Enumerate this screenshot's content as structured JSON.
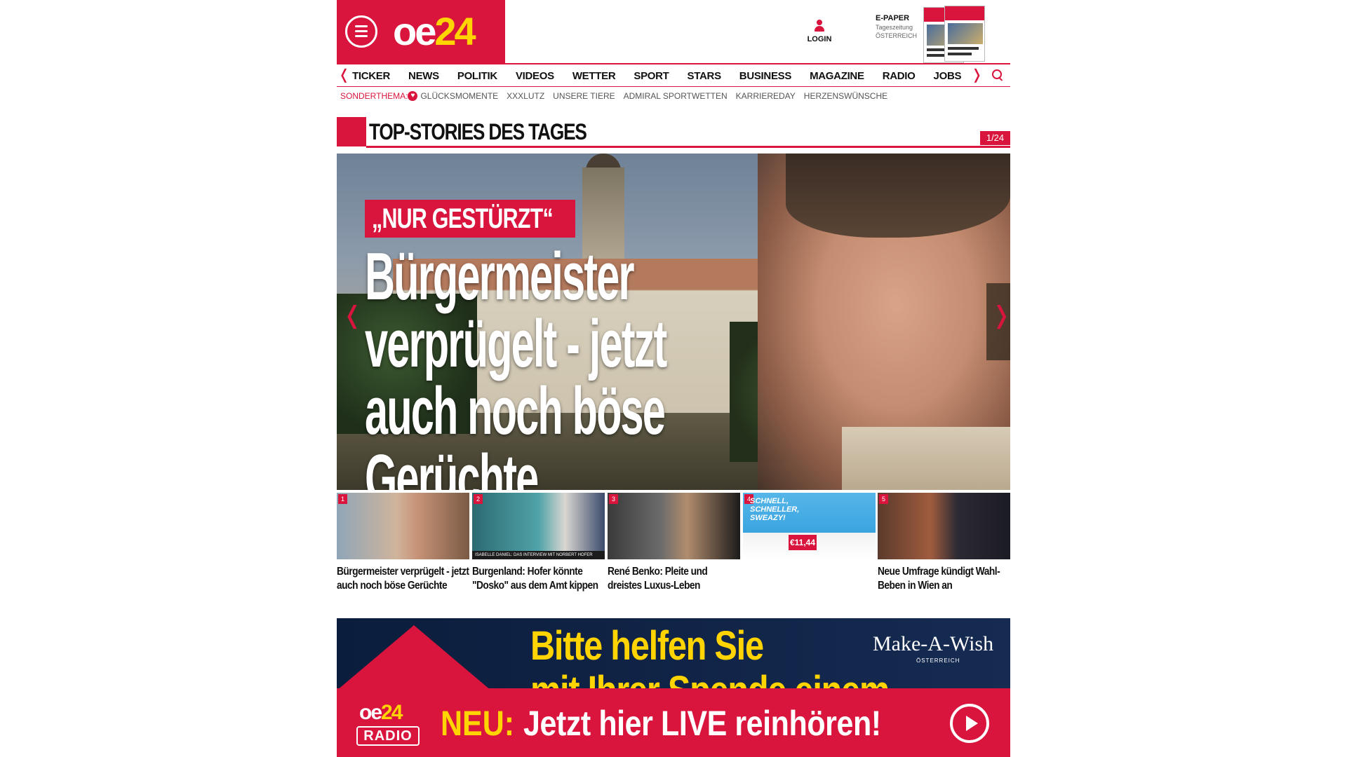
{
  "brand": {
    "logo_prefix": "oe",
    "logo_number": "24"
  },
  "header": {
    "login_label": "LOGIN",
    "epaper_title": "E-PAPER",
    "epaper_sub1": "Tageszeitung",
    "epaper_sub2": "ÖSTERREICH"
  },
  "nav": {
    "items": [
      "TICKER",
      "NEWS",
      "POLITIK",
      "VIDEOS",
      "WETTER",
      "SPORT",
      "STARS",
      "BUSINESS",
      "MAGAZINE",
      "RADIO",
      "JOBS"
    ],
    "prev_arrow": "❬",
    "next_arrow": "❭"
  },
  "subnav": {
    "label": "SONDERTHEMA:",
    "items": [
      "GLÜCKSMOMENTE",
      "XXXLUTZ",
      "UNSERE TIERE",
      "ADMIRAL SPORTWETTEN",
      "KARRIEREDAY",
      "HERZENSWÜNSCHE"
    ]
  },
  "section": {
    "title": "TOP-STORIES DES TAGES",
    "counter": "1/24"
  },
  "hero": {
    "kicker": "„NUR GESTÜRZT“",
    "headline_line1": "Bürgermeister",
    "headline_line2": "verprügelt - jetzt",
    "headline_line3": "auch noch böse Gerüchte",
    "prev_arrow": "❬",
    "next_arrow": "❭"
  },
  "thumbs": [
    {
      "num": "1",
      "caption": "Bürgermeister verprügelt - jetzt auch noch böse Gerüchte"
    },
    {
      "num": "2",
      "caption": "Burgenland: Hofer könnte \"Dosko\" aus dem Amt kippen",
      "strip": "ISABELLE DANIEL: DAS INTERVIEW MIT NORBERT HOFER"
    },
    {
      "num": "3",
      "caption": "René Benko: Pleite und dreistes Luxus-Leben"
    },
    {
      "num": "4",
      "caption": "",
      "promo1": "SCHNELL,",
      "promo2": "SCHNELLER,",
      "promo3": "SWEAZY!",
      "price": "€11,44"
    },
    {
      "num": "5",
      "caption": "Neue Umfrage kündigt Wahl-Beben in Wien an"
    }
  ],
  "ad": {
    "line1": "Bitte helfen Sie",
    "line2": "mit Ihrer Spende einem",
    "brand": "Make-A-Wish",
    "brand_sub": "ÖSTERREICH"
  },
  "radio": {
    "logo_prefix": "oe",
    "logo_number": "24",
    "logo_label": "RADIO",
    "neu": "NEU:",
    "cta": "Jetzt hier LIVE reinhören!"
  },
  "colors": {
    "brand_red": "#d9143d",
    "brand_yellow": "#ffd400"
  }
}
